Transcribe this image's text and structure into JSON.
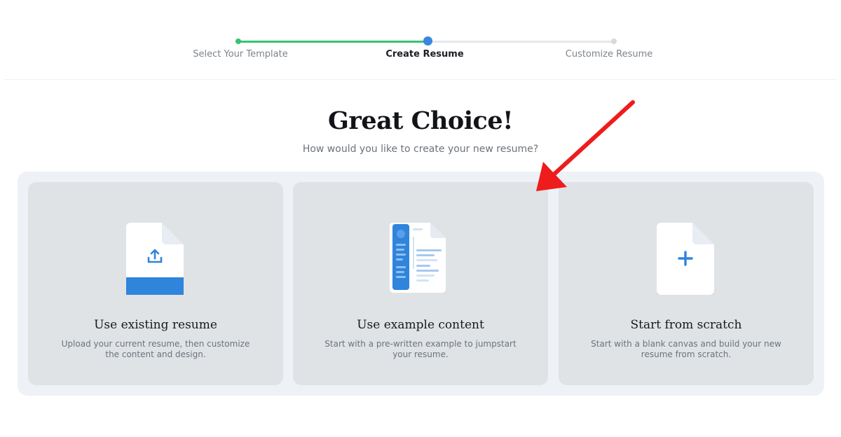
{
  "stepper": {
    "steps": [
      {
        "label": "Select Your Template",
        "state": "completed"
      },
      {
        "label": "Create Resume",
        "state": "current"
      },
      {
        "label": "Customize Resume",
        "state": "upcoming"
      }
    ]
  },
  "header": {
    "title": "Great Choice!",
    "subtitle": "How would you like to create your new resume?"
  },
  "options": [
    {
      "title": "Use existing resume",
      "description": "Upload your current resume, then customize the content and design.",
      "icon": "upload-document-icon"
    },
    {
      "title": "Use example content",
      "description": "Start with a pre-written example to jumpstart your resume.",
      "icon": "example-resume-icon"
    },
    {
      "title": "Start from scratch",
      "description": "Start with a blank canvas and build your new resume from scratch.",
      "icon": "blank-document-plus-icon"
    }
  ],
  "colors": {
    "progress_done": "#35c46f",
    "progress_current": "#3a86e0",
    "card_background": "#dfe3e6",
    "accent_blue": "#2f84dc",
    "annotation_arrow": "#ee1c1c"
  }
}
